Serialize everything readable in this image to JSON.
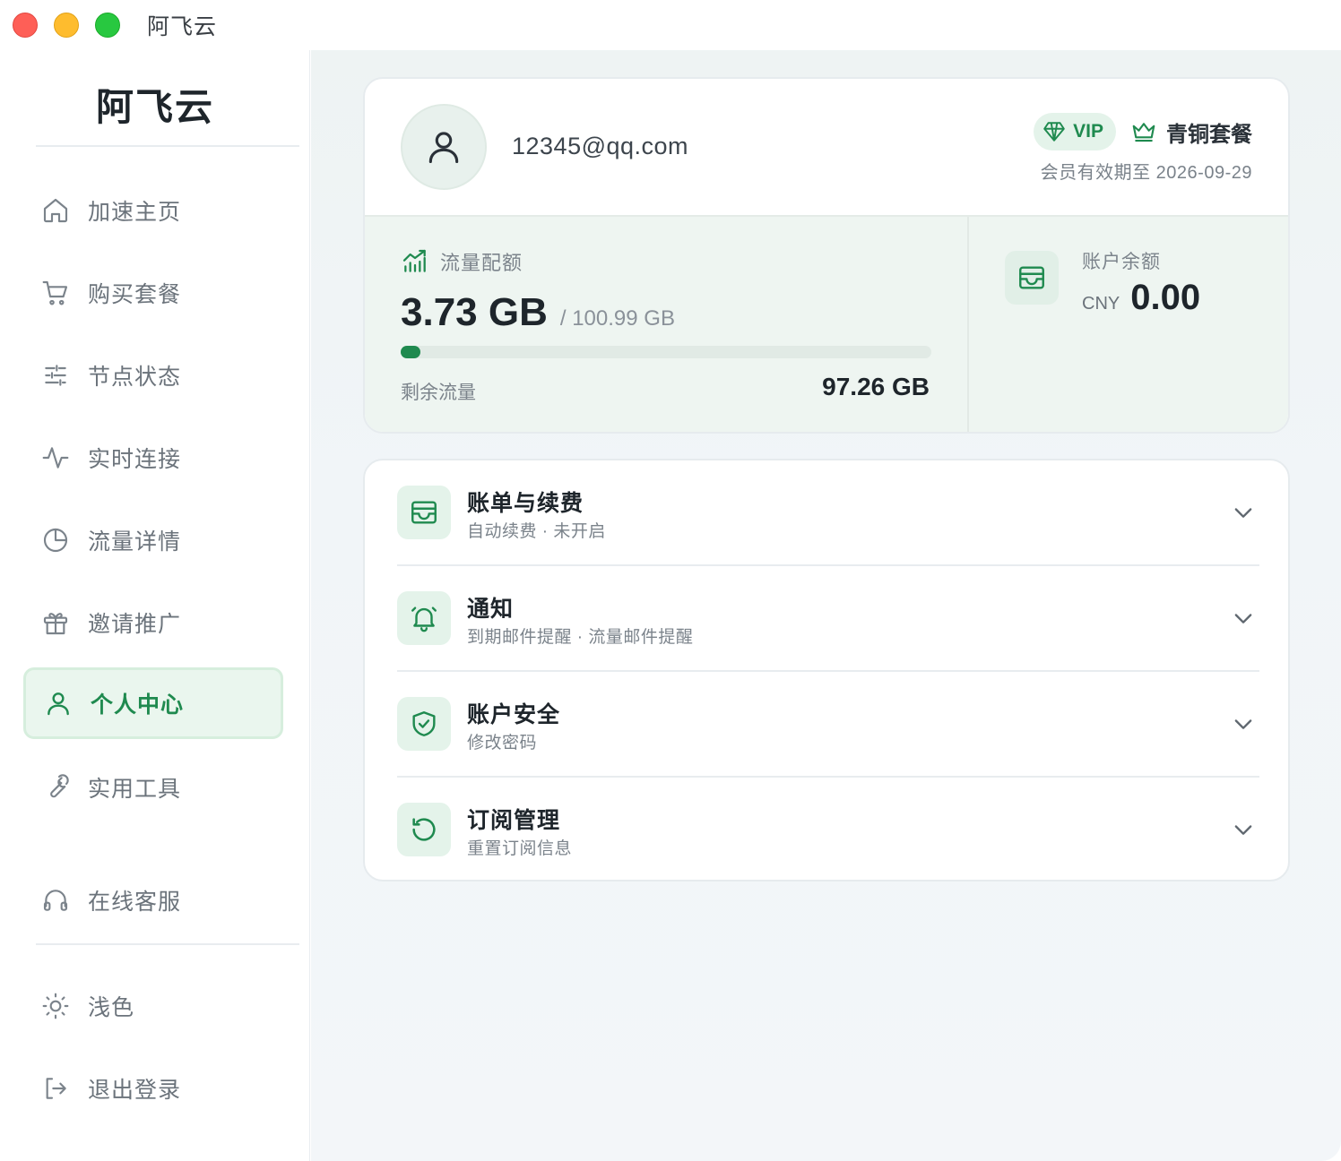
{
  "window": {
    "title": "阿飞云"
  },
  "sidebar": {
    "brand": "阿飞云",
    "items": [
      {
        "label": "加速主页",
        "icon": "home-icon"
      },
      {
        "label": "购买套餐",
        "icon": "cart-icon"
      },
      {
        "label": "节点状态",
        "icon": "sliders-icon"
      },
      {
        "label": "实时连接",
        "icon": "activity-icon"
      },
      {
        "label": "流量详情",
        "icon": "pie-chart-icon"
      },
      {
        "label": "邀请推广",
        "icon": "gift-icon"
      },
      {
        "label": "个人中心",
        "icon": "user-icon",
        "active": true
      },
      {
        "label": "实用工具",
        "icon": "wrench-icon"
      },
      {
        "label": "在线客服",
        "icon": "headphones-icon"
      }
    ],
    "bottom": [
      {
        "label": "浅色",
        "icon": "sun-icon"
      },
      {
        "label": "退出登录",
        "icon": "logout-icon"
      }
    ]
  },
  "profile": {
    "email": "12345@qq.com",
    "vip_label": "VIP",
    "plan_name": "青铜套餐",
    "expiry": "会员有效期至 2026-09-29"
  },
  "traffic": {
    "label": "流量配额",
    "used": "3.73 GB",
    "total": "/ 100.99 GB",
    "used_fraction": 0.037,
    "remaining_label": "剩余流量",
    "remaining": "97.26 GB"
  },
  "balance": {
    "label": "账户余额",
    "currency": "CNY",
    "value": "0.00"
  },
  "settings": [
    {
      "title": "账单与续费",
      "subtitle": "自动续费 · 未开启",
      "icon": "wallet-icon"
    },
    {
      "title": "通知",
      "subtitle": "到期邮件提醒 · 流量邮件提醒",
      "icon": "bell-icon"
    },
    {
      "title": "账户安全",
      "subtitle": "修改密码",
      "icon": "shield-check-icon"
    },
    {
      "title": "订阅管理",
      "subtitle": "重置订阅信息",
      "icon": "refresh-icon"
    }
  ],
  "colors": {
    "accent": "#1f8a4f",
    "accent_bg": "#e4f3ea"
  }
}
